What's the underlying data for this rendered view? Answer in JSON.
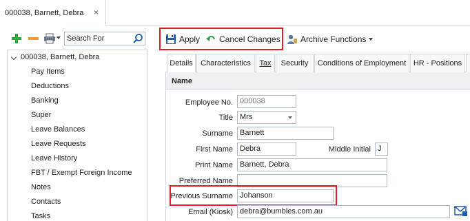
{
  "document_tab": {
    "label": "000038, Barnett, Debra",
    "close": "×"
  },
  "left_toolbar": {
    "add_icon": "plus-icon",
    "remove_icon": "minus-icon",
    "print_icon": "printer-icon",
    "search_placeholder": "Search For"
  },
  "tree": {
    "root_label": "000038, Barnett, Debra",
    "items": [
      "Pay Items",
      "Deductions",
      "Banking",
      "Super",
      "Leave Balances",
      "Leave Requests",
      "Leave History",
      "FBT / Exempt Foreign Income",
      "Notes",
      "Contacts",
      "Tasks"
    ]
  },
  "toolbar": {
    "apply_label": "Apply",
    "cancel_label": "Cancel Changes",
    "archive_label": "Archive Functions"
  },
  "tabs": [
    "Details",
    "Characteristics",
    "Tax",
    "Security",
    "Conditions of Employment",
    "HR - Positions"
  ],
  "section": {
    "title": "Name"
  },
  "form": {
    "employee_no": {
      "label": "Employee No.",
      "value": "000038"
    },
    "title": {
      "label": "Title",
      "value": "Mrs"
    },
    "surname": {
      "label": "Surname",
      "value": "Barnett"
    },
    "first_name": {
      "label": "First Name",
      "value": "Debra"
    },
    "middle_initial": {
      "label": "Middle Initial",
      "value": "J"
    },
    "print_name": {
      "label": "Print Name",
      "value": "Barnett, Debra"
    },
    "preferred_name": {
      "label": "Preferred Name",
      "value": ""
    },
    "previous_surname": {
      "label": "Previous Surname",
      "value": "Johanson"
    },
    "email_kiosk": {
      "label": "Email (Kiosk)",
      "value": "debra@bumbles.com.au"
    }
  },
  "colors": {
    "highlight": "#e01b22",
    "add_green": "#2eaa3f",
    "remove_orange": "#f39b31",
    "accent_blue": "#1f5fae"
  }
}
